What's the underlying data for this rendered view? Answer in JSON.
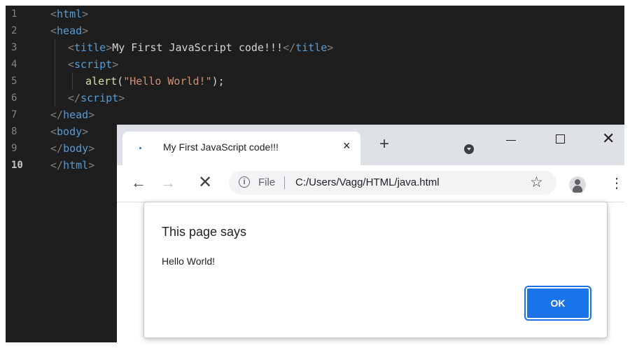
{
  "editor": {
    "line_numbers": [
      "1",
      "2",
      "3",
      "4",
      "5",
      "6",
      "7",
      "8",
      "9",
      "10"
    ],
    "active_line": "10",
    "lines": [
      {
        "indent": 0,
        "parts": [
          [
            "<",
            "b"
          ],
          [
            "html",
            "t"
          ],
          [
            ">",
            "b"
          ]
        ]
      },
      {
        "indent": 0,
        "parts": [
          [
            "<",
            "b"
          ],
          [
            "head",
            "t"
          ],
          [
            ">",
            "b"
          ]
        ]
      },
      {
        "indent": 1,
        "parts": [
          [
            "<",
            "b"
          ],
          [
            "title",
            "t"
          ],
          [
            ">",
            "b"
          ],
          [
            "My First JavaScript code!!!",
            "x"
          ],
          [
            "</",
            "b"
          ],
          [
            "title",
            "t"
          ],
          [
            ">",
            "b"
          ]
        ]
      },
      {
        "indent": 1,
        "parts": [
          [
            "<",
            "b"
          ],
          [
            "script",
            "t"
          ],
          [
            ">",
            "b"
          ]
        ]
      },
      {
        "indent": 2,
        "parts": [
          [
            "alert",
            "f"
          ],
          [
            "(",
            "x"
          ],
          [
            "\"Hello World!\"",
            "s"
          ],
          [
            ");",
            "x"
          ]
        ]
      },
      {
        "indent": 1,
        "parts": [
          [
            "</",
            "b"
          ],
          [
            "script",
            "t"
          ],
          [
            ">",
            "b"
          ]
        ]
      },
      {
        "indent": 0,
        "parts": [
          [
            "</",
            "b"
          ],
          [
            "head",
            "t"
          ],
          [
            ">",
            "b"
          ]
        ]
      },
      {
        "indent": 0,
        "parts": [
          [
            "<",
            "b"
          ],
          [
            "body",
            "t"
          ],
          [
            ">",
            "b"
          ]
        ]
      },
      {
        "indent": 0,
        "parts": [
          [
            "</",
            "b"
          ],
          [
            "body",
            "t"
          ],
          [
            ">",
            "b"
          ]
        ]
      },
      {
        "indent": 0,
        "parts": [
          [
            "</",
            "b"
          ],
          [
            "html",
            "t"
          ],
          [
            ">",
            "b"
          ]
        ]
      }
    ]
  },
  "browser": {
    "tab": {
      "title": "My First JavaScript code!!!",
      "close": "×"
    },
    "new_tab": "+",
    "window": {
      "close": "✕"
    },
    "toolbar": {
      "back": "←",
      "forward": "→",
      "stop": "✕",
      "info_glyph": "i",
      "scheme_label": "File",
      "url": "C:/Users/Vagg/HTML/java.html",
      "star": "☆",
      "menu": "⋮"
    }
  },
  "dialog": {
    "title": "This page says",
    "message": "Hello World!",
    "ok_label": "OK"
  },
  "colors": {
    "editor_bg": "#1e1e1e",
    "tag": "#569cd6",
    "string": "#ce9178",
    "function": "#dcdcaa",
    "accent": "#1a73e8"
  }
}
